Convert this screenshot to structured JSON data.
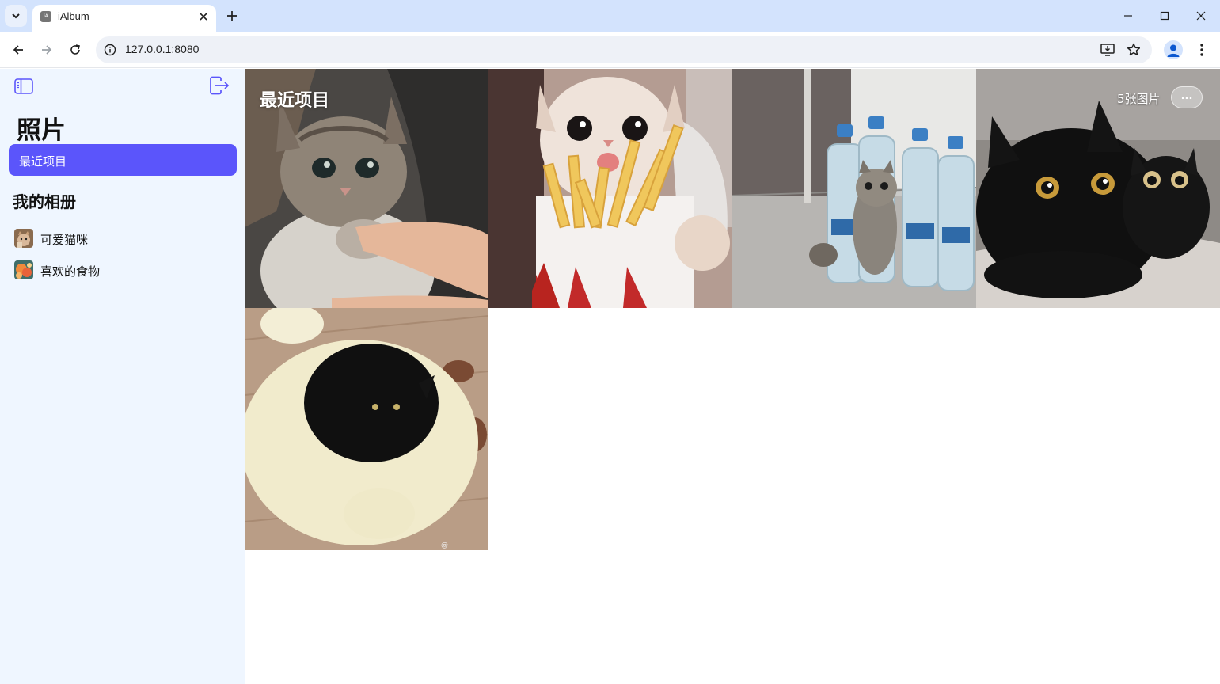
{
  "browser": {
    "tab_title": "iAlbum",
    "favicon_text": "iA",
    "url": "127.0.0.1:8080"
  },
  "sidebar": {
    "title": "照片",
    "active_item": "最近项目",
    "section_title": "我的相册",
    "albums": [
      {
        "label": "可爱猫咪",
        "thumb": "cute-cat-album-thumbnail"
      },
      {
        "label": "喜欢的食物",
        "thumb": "favorite-food-album-thumbnail"
      }
    ]
  },
  "main": {
    "title": "最近项目",
    "count": "5张图片",
    "more_label": "...",
    "photos": [
      {
        "name": "kitten-biting-finger"
      },
      {
        "name": "cat-with-french-fries"
      },
      {
        "name": "kitten-between-water-bottles"
      },
      {
        "name": "black-cat-with-plush"
      },
      {
        "name": "black-cat-in-round-bed"
      }
    ]
  },
  "colors": {
    "accent": "#5b55fb",
    "sidebar_bg": "#eff6ff",
    "tabstrip_bg": "#d3e3fd"
  }
}
